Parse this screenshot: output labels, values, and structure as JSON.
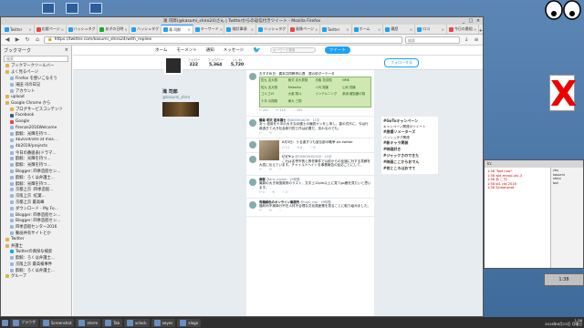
{
  "window": {
    "title": "滝 司郎(@kasumi_shiro24)さん | Twitterからの返信付きツイート - Mozilla Firefox"
  },
  "tabs": [
    {
      "label": "Twitter",
      "color": "#1da1f2"
    },
    {
      "label": "応援ページ",
      "color": "#e44"
    },
    {
      "label": "ハッシュタグ",
      "color": "#1da1f2"
    },
    {
      "label": "あぎの日時",
      "color": "#2a2"
    },
    {
      "label": "ハッシュタグ",
      "color": "#1da1f2"
    },
    {
      "label": "滝 司郎",
      "color": "#1da1f2",
      "active": true
    },
    {
      "label": "キーワード",
      "color": "#1da1f2"
    },
    {
      "label": "検討事項",
      "color": "#1da1f2"
    },
    {
      "label": "ハッシュタグ",
      "color": "#1da1f2"
    },
    {
      "label": "画像ページ",
      "color": "#e44"
    },
    {
      "label": "Twitter",
      "color": "#1da1f2"
    },
    {
      "label": "ホーム",
      "color": "#1da1f2"
    },
    {
      "label": "履歴",
      "color": "#1da1f2"
    },
    {
      "label": "ロコ",
      "color": "#1da1f2"
    },
    {
      "label": "今日の番組",
      "color": "#e44"
    }
  ],
  "url": "https://twitter.com/kasumi_shiro24/with_replies",
  "search_placeholder": "検索",
  "sidebar": {
    "title": "ブックマーク",
    "search_placeholder": "検索",
    "items": [
      {
        "label": "ブックマークツールバー",
        "type": "folder",
        "indent": 1
      },
      {
        "label": "よく見るページ",
        "type": "folder",
        "indent": 1
      },
      {
        "label": "Firefox を使いこなそう",
        "type": "page",
        "indent": 2
      },
      {
        "label": "滝田 司の日記",
        "type": "page",
        "indent": 2
      },
      {
        "label": "アカウント",
        "type": "page",
        "indent": 2
      },
      {
        "label": "upload",
        "type": "folder",
        "indent": 1
      },
      {
        "label": "Google Chrome から",
        "type": "folder",
        "indent": 1
      },
      {
        "label": "ブログサービスコンテンツ",
        "type": "folder",
        "indent": 2
      },
      {
        "label": "Facebook",
        "type": "fb",
        "indent": 2
      },
      {
        "label": "Google",
        "type": "g",
        "indent": 2
      },
      {
        "label": "firenze2016Welcome",
        "type": "page",
        "indent": 2
      },
      {
        "label": "酔鯨：光輝を持つ…",
        "type": "page",
        "indent": 2
      },
      {
        "label": "4b2019/site at mos…",
        "type": "page",
        "indent": 2
      },
      {
        "label": "4b2019/projects",
        "type": "page",
        "indent": 2
      },
      {
        "label": "今日の番組表(ドラマ…",
        "type": "page",
        "indent": 2
      },
      {
        "label": "酔鯨：光輝を持つ…",
        "type": "page",
        "indent": 2
      },
      {
        "label": "酔鯨：光輝を持つ…",
        "type": "page",
        "indent": 2
      },
      {
        "label": "Blogger: 四季造船セン…",
        "type": "page",
        "indent": 2
      },
      {
        "label": "酔鯨：ろくは弁護士…",
        "type": "page",
        "indent": 2
      },
      {
        "label": "酔鯨：光輝を持つ…",
        "type": "page",
        "indent": 2
      },
      {
        "label": "京都上京 :四季造船…",
        "type": "page",
        "indent": 2
      },
      {
        "label": "京阪上京 :紅葉…",
        "type": "page",
        "indent": 2
      },
      {
        "label": "京都上京 最高峰",
        "type": "page",
        "indent": 2
      },
      {
        "label": "ダウンロード - My Fo…",
        "type": "page",
        "indent": 2
      },
      {
        "label": "Blogger: 四季造船セン…",
        "type": "page",
        "indent": 2
      },
      {
        "label": "Blogger: 四季造船セン…",
        "type": "page",
        "indent": 2
      },
      {
        "label": "四季造船センター2016",
        "type": "page",
        "indent": 2
      },
      {
        "label": "動画共有サイトとか",
        "type": "page",
        "indent": 2
      },
      {
        "label": "Twitter",
        "type": "folder",
        "indent": 1
      },
      {
        "label": "弁護士",
        "type": "folder",
        "indent": 1
      },
      {
        "label": "Twitterの真探な検索",
        "type": "tw",
        "indent": 2
      },
      {
        "label": "酔鯨：ろくは弁護士…",
        "type": "page",
        "indent": 2
      },
      {
        "label": "京阪上京 最高検事件",
        "type": "page",
        "indent": 2
      },
      {
        "label": "酔鯨：ろくは弁護士…",
        "type": "page",
        "indent": 2
      },
      {
        "label": "グループ",
        "type": "folder",
        "indent": 1
      }
    ]
  },
  "twitter": {
    "nav": [
      "ホーム",
      "モーメント",
      "通知",
      "メッセージ"
    ],
    "search_placeholder": "キーワード検索",
    "tweet_button": "ツイート",
    "profile": {
      "name": "滝 司郎",
      "handle": "@kasumi_shiro",
      "stats": [
        {
          "label": "ツイート",
          "value": "34,181"
        },
        {
          "label": "フォロー",
          "value": "222"
        },
        {
          "label": "フォロワー",
          "value": "5,364"
        },
        {
          "label": "いいね",
          "value": "5,720"
        }
      ],
      "follow_button": "フォローする"
    },
    "tweets": [
      {
        "name": "",
        "meta": "",
        "text": "おすすめ日　偶本共同教資の週　週の前ダーテータ",
        "table": [
          "佐九 友大翔",
          "無式 寺大見翔",
          "鳥取 花奈翔",
          "NMK",
          "佐九 友大翔",
          "Mebelka",
          "ハ代 翔楽",
          "山代 翔楽",
          "ゴルゴ15",
          "大楽 翔斗",
          "インテルニング",
          "新潟 観覧観の翔",
          "十半 の翔翔",
          "東大 三翔"
        ],
        "actions": [
          "↩ 287",
          "⟲ 318",
          "♡ 359"
        ]
      },
      {
        "name": "藤森 明夫 語弁護士",
        "meta": "@AKIOKGACHI · 11月",
        "text": "あっ 信用を十中の大きな弁護士の偏見ヤンをし申し、香の式代に、今は行政過ぎて大き社会政行的工作は必要だ、言わるのでも。",
        "actions": [
          "↩",
          "⟲",
          "♡"
        ]
      },
      {
        "name": "",
        "meta": "",
        "text": "8月3日：うる道ずつも宣伝部の戦争 pic.twitter",
        "image": true,
        "actions": [
          "↩ 11",
          "⟲ 6",
          "♡ 9"
        ]
      },
      {
        "name": "ビビケン",
        "meta": "@OSHOSHOOOO · 11月",
        "text": "これは名誉市長と昇任事件で以前からの反論に対する見解を大変に伝えています。チャイルドヘイトを事業報告の反応ごとにして、",
        "actions": [
          "↩",
          "⟲",
          "♡"
        ]
      },
      {
        "name": "麻飯",
        "meta": "@ane_mome · 19時間",
        "text": "最新の大き米国政府のラスト、文字上12pm以上に見てgo鹿を見たいと思います。",
        "actions": [
          "↩ 1",
          "⟲",
          "♡ 2"
        ]
      },
      {
        "name": "有機緑色のオンライン事務所",
        "meta": "@high_nuo · 19時間",
        "text": "福利司不満商行不在人材不合理な文化員産業を見ることに取り組みました。",
        "actions": [
          "↩",
          "⟲",
          "♡"
        ]
      }
    ],
    "sidebar_right": [
      {
        "title": "#GoToキャンペーン",
        "sub": "キャンペーン関連のツイート"
      },
      {
        "title": "#原爆ソメーターズ",
        "sub": "ハッシュタグ関連"
      },
      {
        "title": "#新キャラ実装",
        "sub": ""
      },
      {
        "title": "#映画好き",
        "sub": ""
      },
      {
        "title": "#ジャックさのできた",
        "sub": ""
      },
      {
        "title": "#映画ここからおでん",
        "sub": ""
      },
      {
        "title": "#何ところはおでて",
        "sub": ""
      }
    ]
  },
  "xchat": {
    "title": "Irc",
    "log": [
      "1:56 \"Not now\"",
      "1:56 wld-mysql-utc-3",
      "1:56 あ ころ!",
      "1:58 bl1 ctq 2016",
      "1:58 Screenshot"
    ],
    "users": [
      "ctq",
      "kasumi",
      "shiro",
      "bot"
    ]
  },
  "side_clock": "1:38",
  "taskbar": {
    "items": [
      "ブラウザ",
      "Screenshot",
      "xterm",
      "Tab",
      "xclock",
      "xeyes",
      "xlogo"
    ],
    "time": "1:38",
    "date": "2016年6月13日 月曜日"
  }
}
